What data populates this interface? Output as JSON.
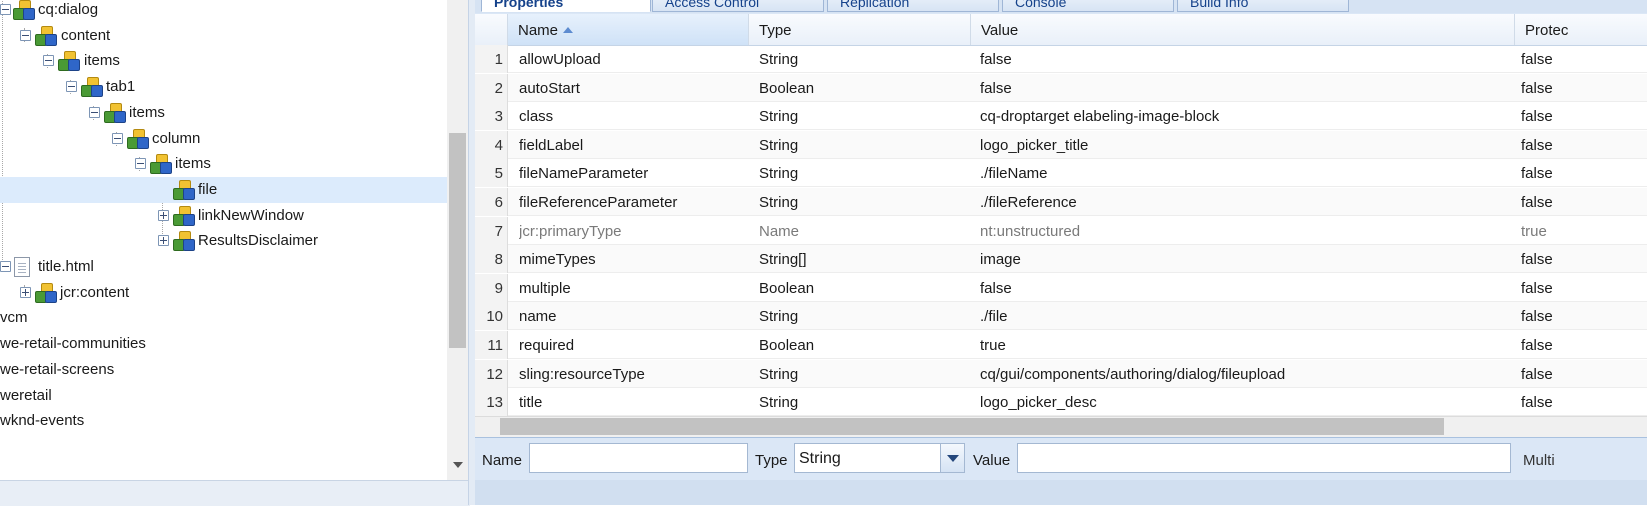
{
  "tree": {
    "items": [
      {
        "label": "cq:dialog",
        "icon": "node-icon",
        "toggle": "minus"
      },
      {
        "label": "content",
        "icon": "node-icon",
        "toggle": "minus"
      },
      {
        "label": "items",
        "icon": "node-icon",
        "toggle": "minus"
      },
      {
        "label": "tab1",
        "icon": "node-icon",
        "toggle": "minus"
      },
      {
        "label": "items",
        "icon": "node-icon",
        "toggle": "minus"
      },
      {
        "label": "column",
        "icon": "node-icon",
        "toggle": "minus"
      },
      {
        "label": "items",
        "icon": "node-icon",
        "toggle": "minus"
      },
      {
        "label": "file",
        "icon": "node-icon",
        "toggle": "none",
        "selected": true
      },
      {
        "label": "linkNewWindow",
        "icon": "node-icon",
        "toggle": "plus"
      },
      {
        "label": "ResultsDisclaimer",
        "icon": "node-icon",
        "toggle": "plus"
      },
      {
        "label": "title.html",
        "icon": "file-icon",
        "toggle": "minus"
      },
      {
        "label": "jcr:content",
        "icon": "node-icon",
        "toggle": "plus"
      },
      {
        "label": "vcm",
        "icon": "none",
        "toggle": "none"
      },
      {
        "label": "we-retail-communities",
        "icon": "none",
        "toggle": "none"
      },
      {
        "label": "we-retail-screens",
        "icon": "none",
        "toggle": "none"
      },
      {
        "label": "weretail",
        "icon": "none",
        "toggle": "none"
      },
      {
        "label": "wknd-events",
        "icon": "none",
        "toggle": "none"
      }
    ]
  },
  "tabs": [
    "Properties",
    "Access Control",
    "Replication",
    "Console",
    "Build Info"
  ],
  "grid": {
    "columns": [
      "Name",
      "Type",
      "Value",
      "Protec"
    ],
    "sorted_column": "Name",
    "rows": [
      {
        "num": "1",
        "name": "allowUpload",
        "type": "String",
        "value": "false",
        "protected": "false"
      },
      {
        "num": "2",
        "name": "autoStart",
        "type": "Boolean",
        "value": "false",
        "protected": "false"
      },
      {
        "num": "3",
        "name": "class",
        "type": "String",
        "value": "cq-droptarget elabeling-image-block",
        "protected": "false"
      },
      {
        "num": "4",
        "name": "fieldLabel",
        "type": "String",
        "value": "logo_picker_title",
        "protected": "false"
      },
      {
        "num": "5",
        "name": "fileNameParameter",
        "type": "String",
        "value": "./fileName",
        "protected": "false"
      },
      {
        "num": "6",
        "name": "fileReferenceParameter",
        "type": "String",
        "value": "./fileReference",
        "protected": "false"
      },
      {
        "num": "7",
        "name": "jcr:primaryType",
        "type": "Name",
        "value": "nt:unstructured",
        "protected": "true"
      },
      {
        "num": "8",
        "name": "mimeTypes",
        "type": "String[]",
        "value": "image",
        "protected": "false"
      },
      {
        "num": "9",
        "name": "multiple",
        "type": "Boolean",
        "value": "false",
        "protected": "false"
      },
      {
        "num": "10",
        "name": "name",
        "type": "String",
        "value": "./file",
        "protected": "false"
      },
      {
        "num": "11",
        "name": "required",
        "type": "Boolean",
        "value": "true",
        "protected": "false"
      },
      {
        "num": "12",
        "name": "sling:resourceType",
        "type": "String",
        "value": "cq/gui/components/authoring/dialog/fileupload",
        "protected": "false"
      },
      {
        "num": "13",
        "name": "title",
        "type": "String",
        "value": "logo_picker_desc",
        "protected": "false"
      }
    ]
  },
  "editbar": {
    "name_label": "Name",
    "name_value": "",
    "type_label": "Type",
    "type_selected": "String",
    "value_label": "Value",
    "value_value": "",
    "multi_label": "Multi"
  },
  "colors": {
    "selected_row": "#dcebfc",
    "panel_bg": "#dbe7f6",
    "tab_text": "#15428b"
  }
}
